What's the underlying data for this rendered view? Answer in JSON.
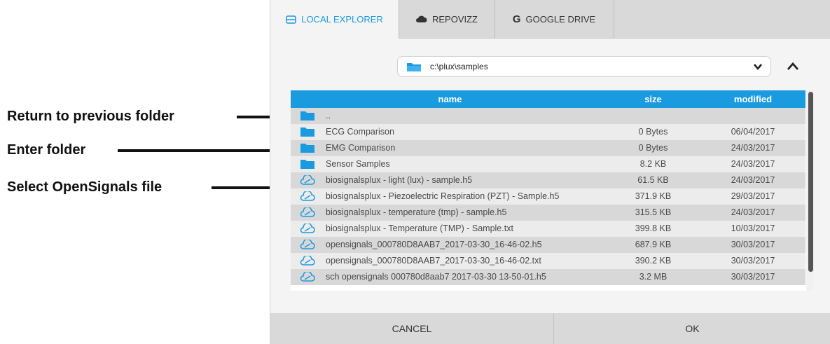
{
  "annotations": [
    {
      "text": "Return to previous folder"
    },
    {
      "text": "Enter folder"
    },
    {
      "text": "Select OpenSignals file"
    }
  ],
  "tabs": [
    {
      "label": "LOCAL EXPLORER",
      "icon": "hard-drive-icon",
      "active": true
    },
    {
      "label": "REPOVIZZ",
      "icon": "cloud-icon",
      "active": false
    },
    {
      "label": "GOOGLE DRIVE",
      "icon": "google-g-icon",
      "active": false
    }
  ],
  "path": {
    "value": "c:\\plux\\samples",
    "icon": "folder-icon"
  },
  "table": {
    "headers": {
      "name": "name",
      "size": "size",
      "modified": "modified"
    },
    "rows": [
      {
        "type": "folder",
        "name": "..",
        "size": "",
        "modified": ""
      },
      {
        "type": "folder",
        "name": "ECG Comparison",
        "size": "0 Bytes",
        "modified": "06/04/2017"
      },
      {
        "type": "folder",
        "name": "EMG Comparison",
        "size": "0 Bytes",
        "modified": "24/03/2017"
      },
      {
        "type": "folder",
        "name": "Sensor Samples",
        "size": "8.2 KB",
        "modified": "24/03/2017"
      },
      {
        "type": "file",
        "name": "biosignalsplux - light (lux) - sample.h5",
        "size": "61.5 KB",
        "modified": "24/03/2017"
      },
      {
        "type": "file",
        "name": "biosignalsplux - Piezoelectric Respiration (PZT) - Sample.h5",
        "size": "371.9 KB",
        "modified": "29/03/2017"
      },
      {
        "type": "file",
        "name": "biosignalsplux - temperature (tmp) - sample.h5",
        "size": "315.5 KB",
        "modified": "24/03/2017"
      },
      {
        "type": "file",
        "name": "biosignalsplux - Temperature (TMP) - Sample.txt",
        "size": "399.8 KB",
        "modified": "10/03/2017"
      },
      {
        "type": "file",
        "name": "opensignals_000780D8AAB7_2017-03-30_16-46-02.h5",
        "size": "687.9 KB",
        "modified": "30/03/2017"
      },
      {
        "type": "file",
        "name": "opensignals_000780D8AAB7_2017-03-30_16-46-02.txt",
        "size": "390.2 KB",
        "modified": "30/03/2017"
      },
      {
        "type": "file",
        "name": "sch opensignals 000780d8aab7 2017-03-30 13-50-01.h5",
        "size": "3.2 MB",
        "modified": "30/03/2017"
      }
    ]
  },
  "footer": {
    "cancel": "CANCEL",
    "ok": "OK"
  },
  "colors": {
    "accent": "#1a9be0",
    "row_odd": "#d8d8d8",
    "row_even": "#ececec"
  }
}
